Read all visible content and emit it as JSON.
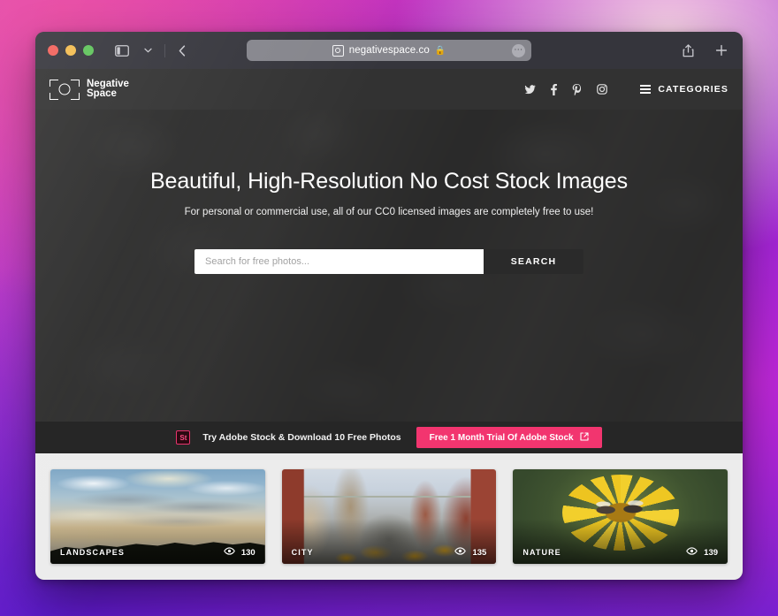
{
  "browser": {
    "traffic_lights": [
      "close",
      "minimize",
      "zoom"
    ],
    "sidebar_icon": "sidebar-icon",
    "tabgroup_icon": "chevron-down-icon",
    "back_icon": "chevron-left-icon",
    "url": "negativespace.co",
    "url_site_icon": "website-icon",
    "url_lock_icon": "lock-icon",
    "url_more_icon": "ellipsis-icon",
    "share_icon": "share-icon",
    "newtab_icon": "plus-icon"
  },
  "site": {
    "logo_line1": "Negative",
    "logo_line2": "Space",
    "social": [
      {
        "name": "twitter",
        "glyph": "𝐓"
      },
      {
        "name": "facebook",
        "glyph": "f"
      },
      {
        "name": "pinterest",
        "glyph": "𝐏"
      },
      {
        "name": "instagram",
        "glyph": "▢"
      }
    ],
    "categories_label": "CATEGORIES"
  },
  "hero": {
    "title": "Beautiful, High-Resolution No Cost Stock Images",
    "subtitle": "For personal or commercial use, all of our CC0 licensed images are completely free to use!",
    "search_placeholder": "Search for free photos...",
    "search_value": "",
    "search_button": "SEARCH"
  },
  "promo": {
    "badge": "St",
    "text": "Try Adobe Stock & Download 10 Free Photos",
    "cta": "Free 1 Month Trial Of Adobe Stock",
    "cta_icon": "external-link-icon",
    "cta_color": "#f2356f"
  },
  "gallery": {
    "cards": [
      {
        "label": "LANDSCAPES",
        "views": "130",
        "image": "sunset-sky-over-treeline"
      },
      {
        "label": "CITY",
        "views": "135",
        "image": "city-street-with-taxis"
      },
      {
        "label": "NATURE",
        "views": "139",
        "image": "bees-on-yellow-flower"
      }
    ],
    "views_icon": "eye-icon"
  }
}
